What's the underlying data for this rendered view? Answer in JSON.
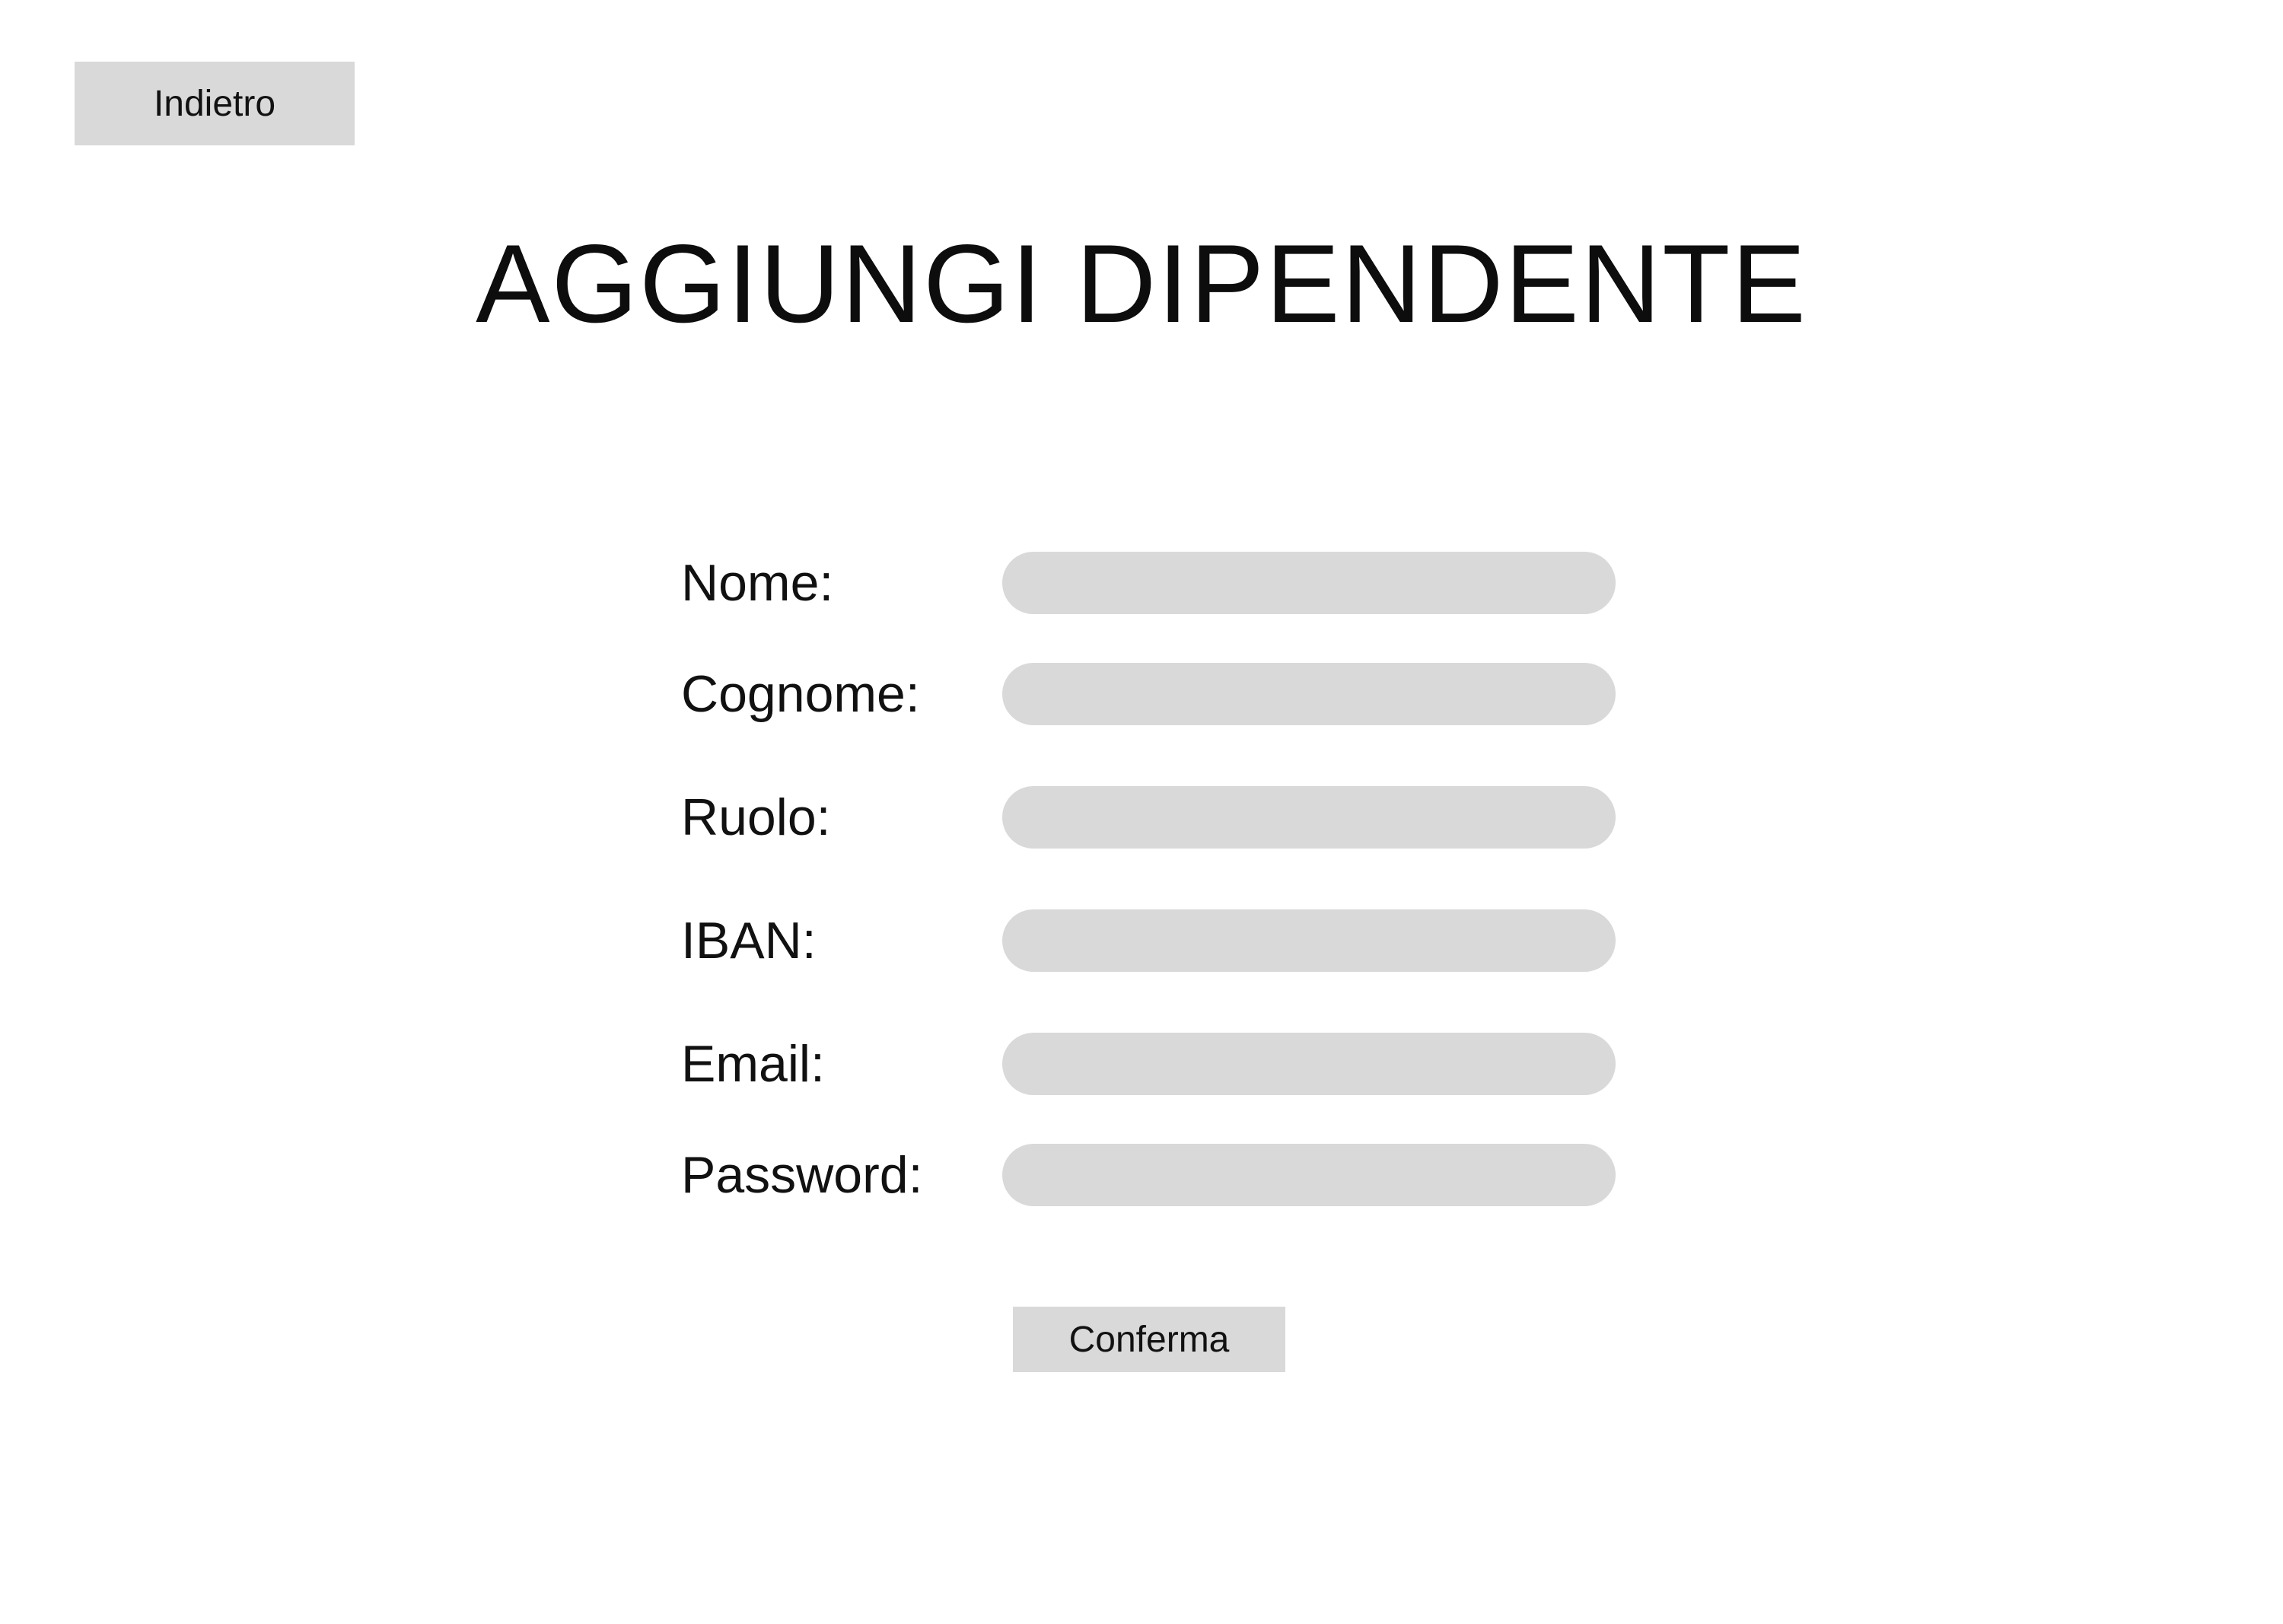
{
  "header": {
    "back_label": "Indietro",
    "title": "AGGIUNGI DIPENDENTE"
  },
  "form": {
    "fields": [
      {
        "label": "Nome:",
        "value": ""
      },
      {
        "label": "Cognome:",
        "value": ""
      },
      {
        "label": "Ruolo:",
        "value": ""
      },
      {
        "label": "IBAN:",
        "value": ""
      },
      {
        "label": "Email:",
        "value": ""
      },
      {
        "label": "Password:",
        "value": ""
      }
    ],
    "confirm_label": "Conferma"
  },
  "colors": {
    "background": "#ffffff",
    "control_fill": "#d9d9d9",
    "text": "#111111"
  }
}
